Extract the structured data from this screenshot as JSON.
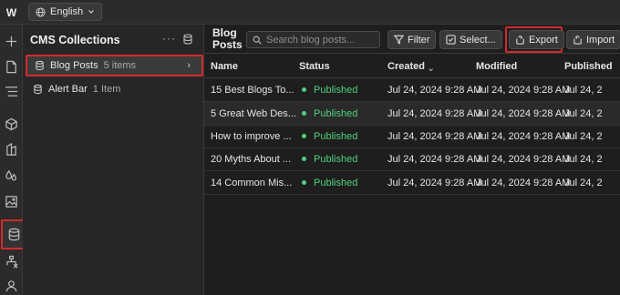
{
  "topbar": {
    "logo": "W",
    "language": "English"
  },
  "rail": {
    "icons": [
      "plus-icon",
      "page-icon",
      "navigator-icon",
      "components-icon",
      "style-icon",
      "color-icon",
      "assets-icon",
      "cms-icon",
      "logic-icon",
      "users-icon"
    ]
  },
  "panel": {
    "title": "CMS Collections",
    "more": "···",
    "collections": [
      {
        "name": "Blog Posts",
        "count": "5 items"
      },
      {
        "name": "Alert Bar",
        "count": "1 Item"
      }
    ]
  },
  "main": {
    "title": "Blog Posts",
    "search_placeholder": "Search blog posts...",
    "filter_label": "Filter",
    "select_label": "Select...",
    "export_label": "Export",
    "import_label": "Import",
    "columns": [
      "Name",
      "Status",
      "Created",
      "Modified",
      "Published"
    ],
    "rows": [
      {
        "name": "15 Best Blogs To...",
        "status": "Published",
        "created": "Jul 24, 2024 9:28 AM",
        "modified": "Jul 24, 2024 9:28 AM",
        "published": "Jul 24, 2"
      },
      {
        "name": "5 Great Web Des...",
        "status": "Published",
        "created": "Jul 24, 2024 9:28 AM",
        "modified": "Jul 24, 2024 9:28 AM",
        "published": "Jul 24, 2"
      },
      {
        "name": "How to improve ...",
        "status": "Published",
        "created": "Jul 24, 2024 9:28 AM",
        "modified": "Jul 24, 2024 9:28 AM",
        "published": "Jul 24, 2"
      },
      {
        "name": "20 Myths About ...",
        "status": "Published",
        "created": "Jul 24, 2024 9:28 AM",
        "modified": "Jul 24, 2024 9:28 AM",
        "published": "Jul 24, 2"
      },
      {
        "name": "14 Common Mis...",
        "status": "Published",
        "created": "Jul 24, 2024 9:28 AM",
        "modified": "Jul 24, 2024 9:28 AM",
        "published": "Jul 24, 2"
      }
    ]
  },
  "colors": {
    "accent_highlight": "#d42a2a",
    "published": "#4fd17a"
  }
}
